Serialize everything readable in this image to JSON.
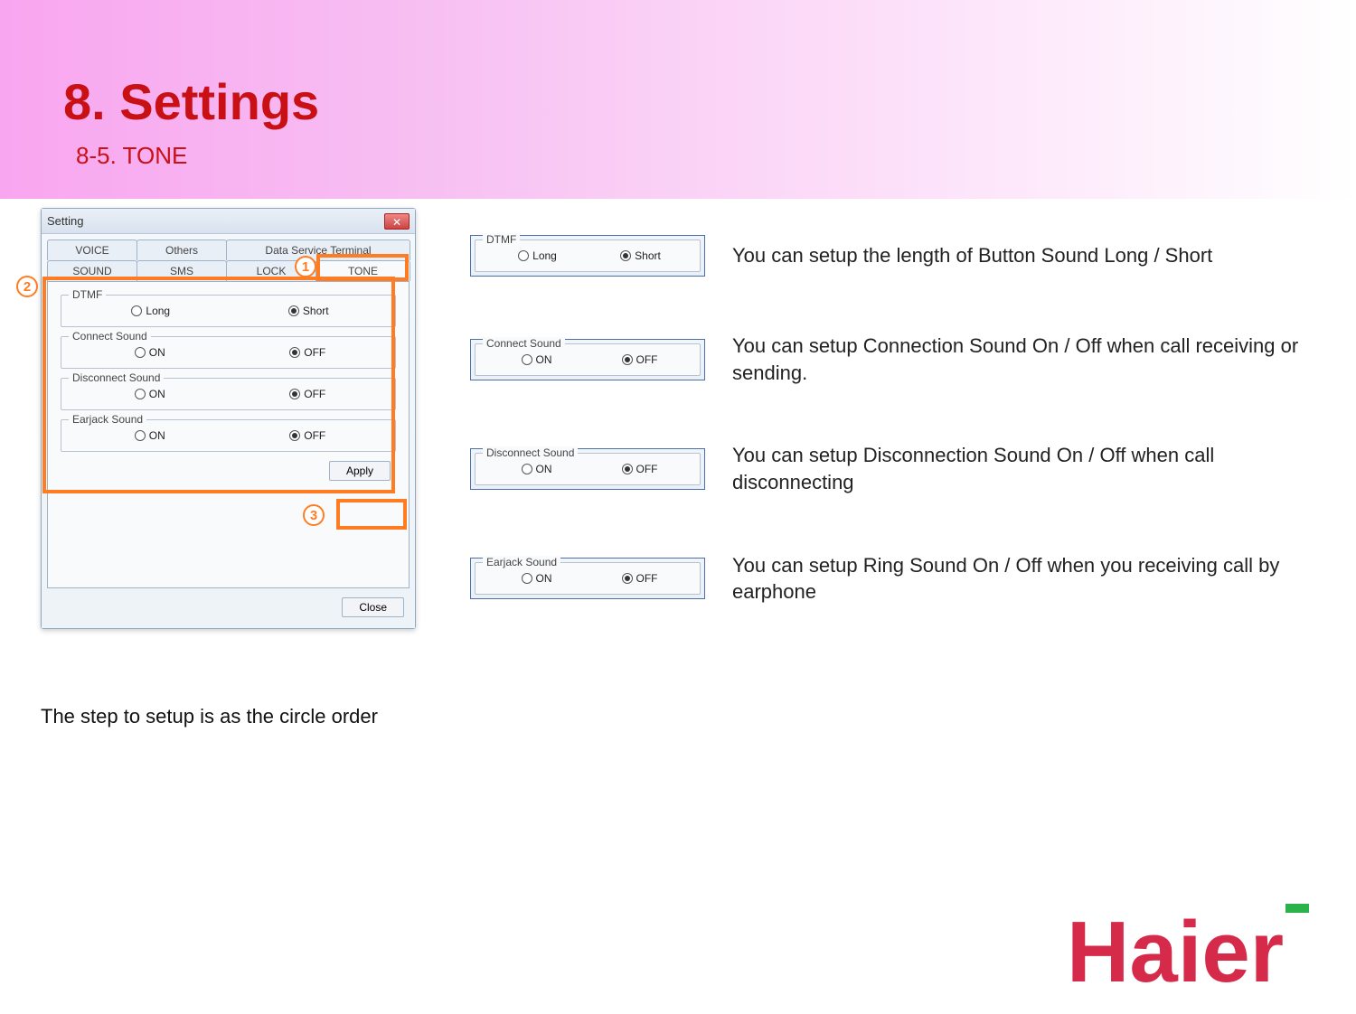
{
  "banner": {
    "title": "8. Settings",
    "subtitle": "8-5. TONE"
  },
  "dialog": {
    "title": "Setting",
    "tabs_row1": [
      "VOICE",
      "Others",
      "Data Service Terminal"
    ],
    "tabs_row2": [
      "SOUND",
      "SMS",
      "LOCK",
      "TONE"
    ],
    "groups": {
      "dtmf": {
        "legend": "DTMF",
        "opt_a": "Long",
        "opt_b": "Short",
        "selected": "b"
      },
      "connect": {
        "legend": "Connect Sound",
        "opt_a": "ON",
        "opt_b": "OFF",
        "selected": "b"
      },
      "disconnect": {
        "legend": "Disconnect Sound",
        "opt_a": "ON",
        "opt_b": "OFF",
        "selected": "b"
      },
      "earjack": {
        "legend": "Earjack Sound",
        "opt_a": "ON",
        "opt_b": "OFF",
        "selected": "b"
      }
    },
    "apply": "Apply",
    "close": "Close"
  },
  "markers": {
    "one": "1",
    "two": "2",
    "three": "3"
  },
  "descriptions": {
    "dtmf": "You can setup the length of Button Sound Long / Short",
    "connect": "You can setup Connection Sound  On / Off when call receiving or sending.",
    "disconnect": "You can setup Disconnection Sound On / Off when call disconnecting",
    "earjack": "You can setup Ring Sound On / Off when you receiving call by earphone"
  },
  "caption": "The step to setup is as the circle order",
  "logo": "Haier"
}
